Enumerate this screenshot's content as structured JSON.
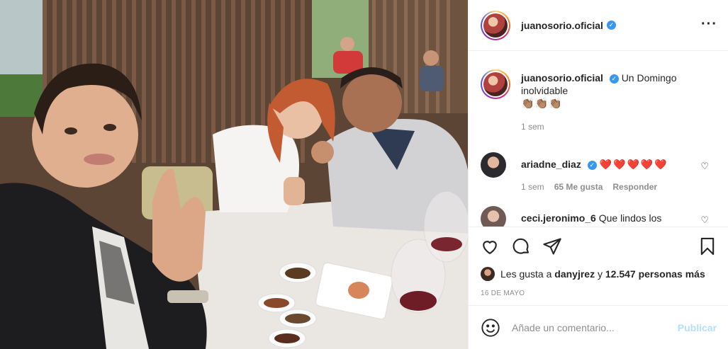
{
  "post": {
    "photo_alt": "",
    "author": {
      "username": "juanosorio.oficial",
      "verified": true
    },
    "more_icon": "more-horizontal-icon",
    "caption": {
      "username": "juanosorio.oficial",
      "text": "Un Domingo inolvidable",
      "emoji": "👏🏽👏🏽👏🏽",
      "age": "1 sem"
    },
    "comments": [
      {
        "username": "ariadne_diaz",
        "verified": true,
        "text": "❤️❤️❤️❤️❤️",
        "age": "1 sem",
        "likes": "65 Me gusta",
        "reply": "Responder"
      },
      {
        "username": "ceci.jeronimo_6",
        "verified": false,
        "text": "Que lindos los"
      }
    ],
    "actions": {
      "like_icon": "heart-icon",
      "comment_icon": "comment-icon",
      "share_icon": "share-icon",
      "save_icon": "bookmark-icon"
    },
    "likes": {
      "prefix": "Les gusta a",
      "user": "danyjrez",
      "joiner": "y",
      "count_text": "12.547 personas más"
    },
    "date": "16 DE MAYO",
    "add_comment": {
      "emoji_icon": "smiley-icon",
      "placeholder": "Añade un comentario...",
      "publish_label": "Publicar"
    },
    "colors": {
      "accent": "#3897f0",
      "publish_disabled": "#b2dffc",
      "heart": "#d91f2f"
    }
  }
}
